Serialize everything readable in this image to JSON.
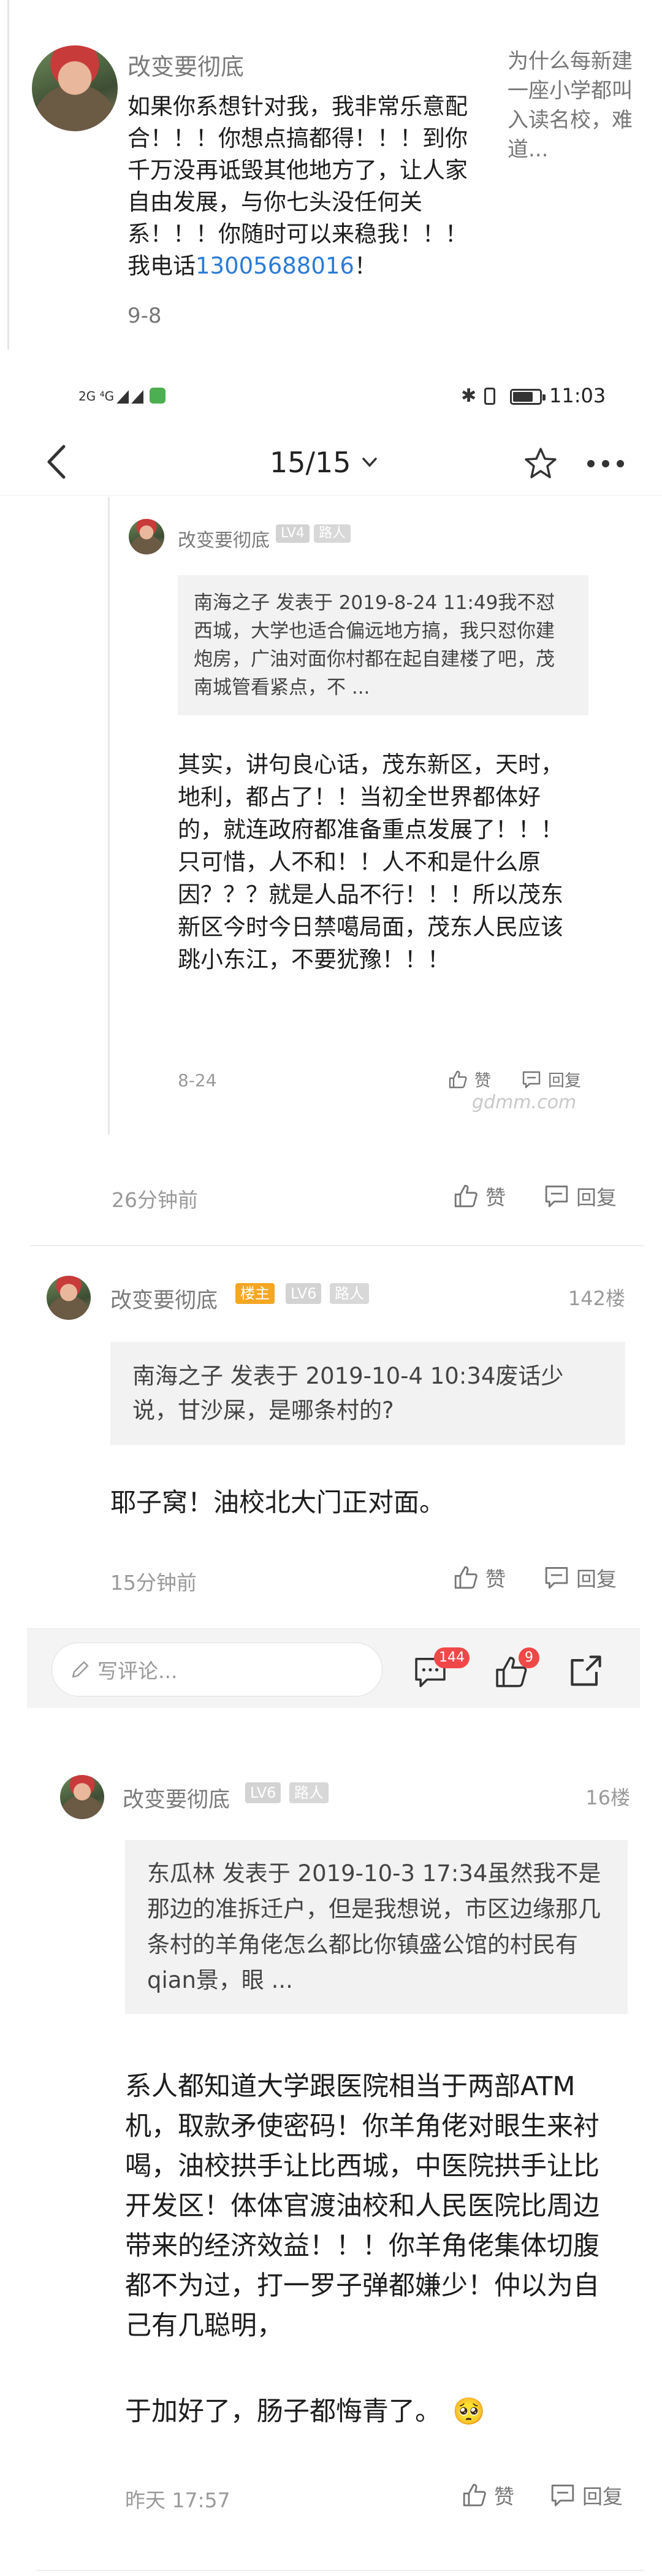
{
  "top_card": {
    "username": "改变要彻底",
    "text_main": "如果你系想针对我，我非常乐意配合！！！你想点搞都得！！！到你千万没再诋毁其他地方了，让人家自由发展，与你七头没任何关系！！！你随时可以来稳我！！！我电话",
    "phone": "13005688016",
    "text_tail": "！",
    "date": "9-8",
    "side_title": "为什么每新建一座小学都叫入读名校，难道..."
  },
  "status_bar": {
    "signal_left": "2G ⁴G",
    "time": "11:03"
  },
  "nav": {
    "page_indicator": "15/15",
    "back_icon": "chevron-left-icon",
    "dropdown_icon": "chevron-down-icon",
    "star_icon": "star-icon",
    "more_icon": "more-icon"
  },
  "comment1_reply": {
    "username": "改变要彻底",
    "level": "LV4",
    "tag": "路人",
    "quote": "南海之子 发表于 2019-8-24 11:49我不怼西城，大学也适合偏远地方搞，我只怼你建炮房，广油对面你村都在起自建楼了吧，茂南城管看紧点，不 ...",
    "body": "其实，讲句良心话，茂东新区，天时，地利，都占了！！当初全世界都体好的，就连政府都准备重点发展了！！！只可惜，人不和！！人不和是什么原因？？？就是人品不行！！！所以茂东新区今时今日禁噶局面，茂东人民应该跳小东江，不要犹豫！！！",
    "date": "8-24",
    "like": "赞",
    "reply": "回复",
    "watermark": "gdmm.com"
  },
  "comment1_footer": {
    "time": "26分钟前",
    "like": "赞",
    "reply": "回复"
  },
  "comment2": {
    "username": "改变要彻底",
    "host_badge": "楼主",
    "level": "LV6",
    "tag": "路人",
    "floor": "142楼",
    "quote": "南海之子 发表于 2019-10-4 10:34废话少说，甘沙屎，是哪条村的?",
    "body": "耶子窝！油校北大门正对面。",
    "time": "15分钟前",
    "like": "赞",
    "reply": "回复"
  },
  "comment_bar": {
    "placeholder": "写评论...",
    "comment_count": "144",
    "like_count": "9",
    "pen_icon": "pen-icon",
    "comment_icon": "comment-icon",
    "like_icon": "thumbs-up-icon",
    "share_icon": "share-icon"
  },
  "comment3": {
    "username": "改变要彻底",
    "level": "LV6",
    "tag": "路人",
    "floor": "16楼",
    "quote": "东瓜林 发表于 2019-10-3 17:34虽然我不是那边的准拆迁户，但是我想说，市区边缘那几条村的羊角佬怎么都比你镇盛公馆的村民有qian景，眼 ...",
    "body": "系人都知道大学跟医院相当于两部ATM机，取款矛使密码！你羊角佬对眼生来衬喝，油校拱手让比西城，中医院拱手让比开发区！体体官渡油校和人民医院比周边带来的经济效益！！！你羊角佬集体切腹都不为过，打一罗子弹都嫌少！仲以为自己有几聪明，",
    "body_last": "于加好了，肠子都悔青了。",
    "emoji": "🥺",
    "time": "昨天 17:57",
    "like": "赞",
    "reply": "回复"
  }
}
